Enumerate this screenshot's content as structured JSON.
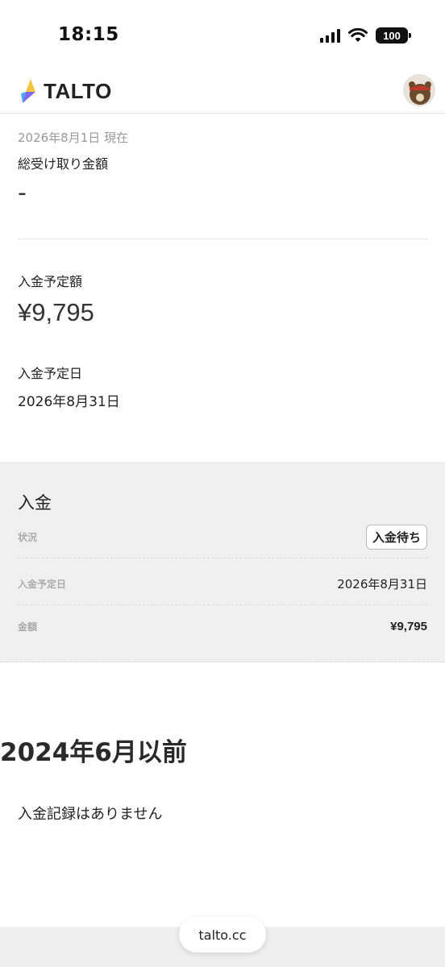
{
  "status_bar": {
    "time": "18:15",
    "battery": "100"
  },
  "header": {
    "brand": "TALTO"
  },
  "summary": {
    "as_of": "2026年8月1日 現在",
    "total_label": "総受け取り金額",
    "total_value": "-",
    "scheduled_amount_label": "入金予定額",
    "scheduled_amount_value": "¥9,795",
    "scheduled_date_label": "入金予定日",
    "scheduled_date_value": "2026年8月31日"
  },
  "deposit": {
    "title": "入金",
    "rows": [
      {
        "label": "状況",
        "value": "入金待ち"
      },
      {
        "label": "入金予定日",
        "value": "2026年8月31日"
      },
      {
        "label": "金額",
        "value": "¥9,795"
      }
    ]
  },
  "history": {
    "heading": "2024年6月以前",
    "empty_message": "入金記録はありません"
  },
  "browser": {
    "url": "talto.cc"
  },
  "colors": {
    "logo_yellow": "#f5c542",
    "logo_purple": "#7b68ee",
    "logo_blue": "#4aa8f0",
    "card_bg": "#f0f0f0"
  }
}
